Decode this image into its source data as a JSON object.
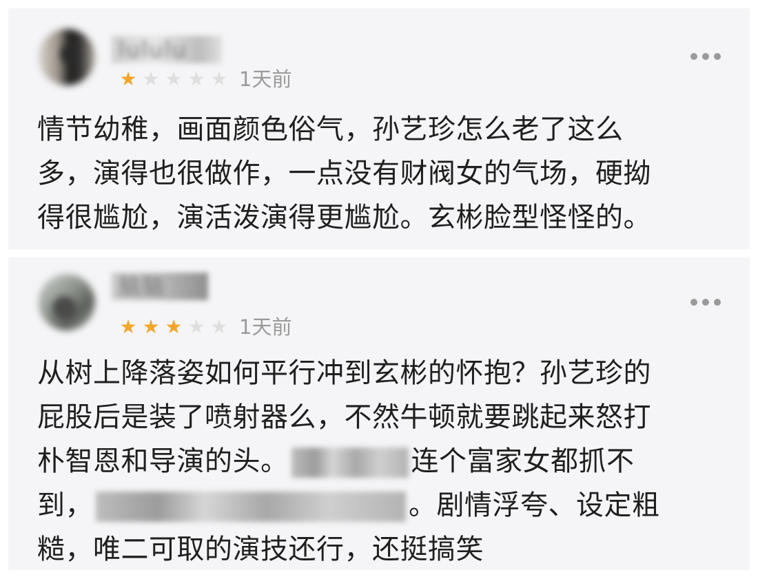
{
  "reviews": [
    {
      "username": "lululu",
      "rating": 1,
      "max_rating": 5,
      "time": "1天前",
      "content_lines": [
        "情节幼稚，画面颜色俗气，孙艺珍怎么老了这么",
        "多，演得也很做作，一点没有财阀女的气场，硬拗",
        "得很尴尬，演活泼演得更尴尬。玄彬脸型怪怪的。"
      ]
    },
    {
      "username": "脑脑",
      "rating": 3,
      "max_rating": 5,
      "time": "1天前",
      "content_lines": [
        "从树上降落姿如何平行冲到玄彬的怀抱？孙艺珍的",
        "屁股后是装了喷射器么，不然牛顿就要跳起来怒打",
        "朴智恩和导演的头。",
        "连个富家女都抓不",
        "到，",
        "。剧情浮夸、设定粗",
        "糙，唯二可取的演技还行，还挺搞笑"
      ]
    }
  ],
  "icons": {
    "star_filled": "star-icon",
    "star_empty": "star-empty-icon",
    "more": "more-icon"
  },
  "colors": {
    "card_background": "#f5f5f7",
    "star_active": "#f3a52c",
    "star_inactive": "#dedede",
    "meta_text": "#9a9a9a",
    "body_text": "#1f1f1f"
  }
}
